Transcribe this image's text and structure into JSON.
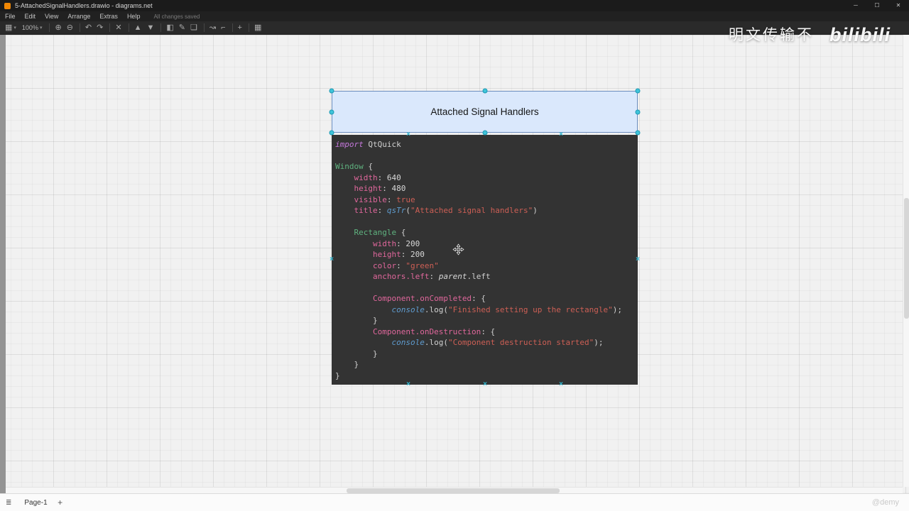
{
  "window": {
    "title": "5-AttachedSignalHandlers.drawio - diagrams.net",
    "minimize": "─",
    "maximize": "☐",
    "close": "✕"
  },
  "menu": {
    "items": [
      "File",
      "Edit",
      "View",
      "Arrange",
      "Extras",
      "Help"
    ],
    "autosave_status": "All changes saved"
  },
  "toolbar": {
    "view_icon": "▦",
    "caret": "▾",
    "zoom_level": "100%",
    "icons": {
      "zoom_in": "⊕",
      "zoom_out": "⊖",
      "undo": "↶",
      "redo": "↷",
      "delete": "✕",
      "to_front": "▲",
      "to_back": "▼",
      "fill_color": "◧",
      "line_color": "✎",
      "shadow": "❏",
      "connection": "↝",
      "waypoints": "⌐",
      "insert": "+",
      "table": "▦"
    }
  },
  "canvas": {
    "shape_title": "Attached Signal Handlers",
    "accent_colors": {
      "shape_fill": "#dae8fc",
      "shape_stroke": "#6c8ebf",
      "selection_handle": "#3fc4da",
      "code_background": "#333333"
    },
    "code": {
      "lines": [
        [
          [
            "kw",
            "import"
          ],
          [
            "pl",
            " QtQuick"
          ]
        ],
        [],
        [
          [
            "type",
            "Window"
          ],
          [
            "pl",
            " {"
          ]
        ],
        [
          [
            "pl",
            "    "
          ],
          [
            "prop",
            "width"
          ],
          [
            "pl",
            ": "
          ],
          [
            "num",
            "640"
          ]
        ],
        [
          [
            "pl",
            "    "
          ],
          [
            "prop",
            "height"
          ],
          [
            "pl",
            ": "
          ],
          [
            "num",
            "480"
          ]
        ],
        [
          [
            "pl",
            "    "
          ],
          [
            "prop",
            "visible"
          ],
          [
            "pl",
            ": "
          ],
          [
            "bool",
            "true"
          ]
        ],
        [
          [
            "pl",
            "    "
          ],
          [
            "prop",
            "title"
          ],
          [
            "pl",
            ": "
          ],
          [
            "fn",
            "qsTr"
          ],
          [
            "pl",
            "("
          ],
          [
            "str",
            "\"Attached signal handlers\""
          ],
          [
            "pl",
            ")"
          ]
        ],
        [],
        [
          [
            "pl",
            "    "
          ],
          [
            "type",
            "Rectangle"
          ],
          [
            "pl",
            " {"
          ]
        ],
        [
          [
            "pl",
            "        "
          ],
          [
            "prop",
            "width"
          ],
          [
            "pl",
            ": "
          ],
          [
            "num",
            "200"
          ]
        ],
        [
          [
            "pl",
            "        "
          ],
          [
            "prop",
            "height"
          ],
          [
            "pl",
            ": "
          ],
          [
            "num",
            "200"
          ]
        ],
        [
          [
            "pl",
            "        "
          ],
          [
            "prop",
            "color"
          ],
          [
            "pl",
            ": "
          ],
          [
            "str",
            "\"green\""
          ]
        ],
        [
          [
            "pl",
            "        "
          ],
          [
            "prop",
            "anchors.left"
          ],
          [
            "pl",
            ": "
          ],
          [
            "ital",
            "parent"
          ],
          [
            "pl",
            ".left"
          ]
        ],
        [],
        [
          [
            "pl",
            "        "
          ],
          [
            "prop",
            "Component.onCompleted"
          ],
          [
            "pl",
            ": {"
          ]
        ],
        [
          [
            "pl",
            "            "
          ],
          [
            "fn",
            "console"
          ],
          [
            "pl",
            ".log("
          ],
          [
            "str",
            "\"Finished setting up the rectangle\""
          ],
          [
            "pl",
            ");"
          ]
        ],
        [
          [
            "pl",
            "        }"
          ]
        ],
        [
          [
            "pl",
            "        "
          ],
          [
            "prop",
            "Component.onDestruction"
          ],
          [
            "pl",
            ": {"
          ]
        ],
        [
          [
            "pl",
            "            "
          ],
          [
            "fn",
            "console"
          ],
          [
            "pl",
            ".log("
          ],
          [
            "str",
            "\"Component destruction started\""
          ],
          [
            "pl",
            ");"
          ]
        ],
        [
          [
            "pl",
            "        }"
          ]
        ],
        [
          [
            "pl",
            "    }"
          ]
        ],
        [
          [
            "pl",
            "}"
          ]
        ]
      ]
    }
  },
  "statusbar": {
    "toggle_icon": "≣",
    "page_tab": "Page-1",
    "add_page": "+",
    "credit": "@demy"
  },
  "watermark": {
    "text": "明文传输不",
    "logo": "bilibili"
  }
}
